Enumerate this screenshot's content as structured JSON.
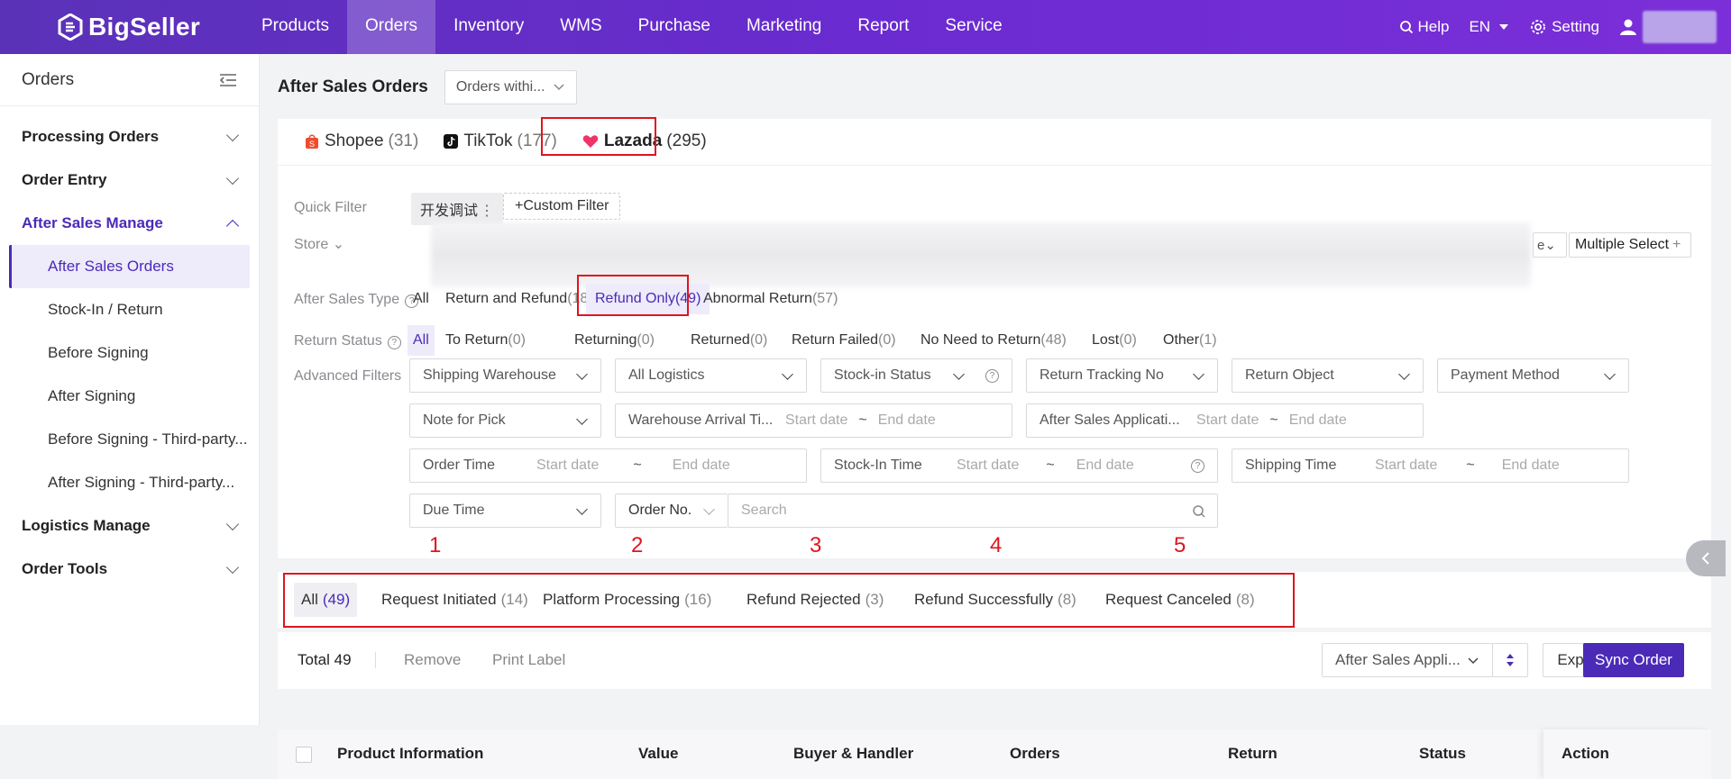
{
  "brand": {
    "name": "BigSeller"
  },
  "nav": {
    "items": [
      "Products",
      "Orders",
      "Inventory",
      "WMS",
      "Purchase",
      "Marketing",
      "Report",
      "Service"
    ],
    "active": "Orders"
  },
  "topright": {
    "help": "Help",
    "lang": "EN",
    "setting": "Setting"
  },
  "sidebar": {
    "title": "Orders",
    "groups": [
      {
        "label": "Processing Orders"
      },
      {
        "label": "Order Entry"
      },
      {
        "label": "After Sales Manage"
      },
      {
        "label": "Logistics Manage"
      },
      {
        "label": "Order Tools"
      }
    ],
    "items": [
      "After Sales Orders",
      "Stock-In / Return",
      "Before Signing",
      "After Signing",
      "Before Signing - Third-party...",
      "After Signing - Third-party..."
    ]
  },
  "page": {
    "title": "After Sales Orders",
    "filter_dropdown": "Orders withi..."
  },
  "platform_tabs": [
    {
      "label": "Shopee",
      "count": "(31)"
    },
    {
      "label": "TikTok",
      "count": "(177)"
    },
    {
      "label": "Lazada",
      "count": "(295)"
    }
  ],
  "filters": {
    "quick_label": "Quick Filter",
    "quick_tag": "开发调试",
    "custom": "Custom Filter",
    "store_label": "Store",
    "multi_select": "Multiple Select",
    "type_label": "After Sales Type",
    "type_options": [
      {
        "label": "All",
        "n": ""
      },
      {
        "label": "Return and Refund",
        "n": "(189)"
      },
      {
        "label": "Refund Only",
        "n": "(49)"
      },
      {
        "label": "Abnormal Return",
        "n": "(57)"
      }
    ],
    "status_label": "Return Status",
    "status_options": [
      {
        "label": "All",
        "n": ""
      },
      {
        "label": "To Return",
        "n": "(0)"
      },
      {
        "label": "Returning",
        "n": "(0)"
      },
      {
        "label": "Returned",
        "n": "(0)"
      },
      {
        "label": "Return Failed",
        "n": "(0)"
      },
      {
        "label": "No Need to Return",
        "n": "(48)"
      },
      {
        "label": "Lost",
        "n": "(0)"
      },
      {
        "label": "Other",
        "n": "(1)"
      }
    ],
    "advanced_label": "Advanced Filters",
    "adv": {
      "shipping_warehouse": "Shipping Warehouse",
      "all_logistics": "All Logistics",
      "stockin_status": "Stock-in Status",
      "return_tracking": "Return Tracking No",
      "return_object": "Return Object",
      "payment_method": "Payment Method",
      "note_pick": "Note for Pick",
      "warehouse_arrival": "Warehouse Arrival Ti...",
      "after_sales_app": "After Sales Applicati...",
      "order_time": "Order Time",
      "stockin_time": "Stock-In Time",
      "shipping_time": "Shipping Time",
      "due_time": "Due Time",
      "order_no": "Order No.",
      "search_ph": "Search",
      "start": "Start date",
      "end": "End date",
      "tilde": "~"
    }
  },
  "annotations": [
    "1",
    "2",
    "3",
    "4",
    "5"
  ],
  "status_tabs": [
    {
      "label": "All",
      "n": "(49)"
    },
    {
      "label": "Request Initiated",
      "n": "(14)"
    },
    {
      "label": "Platform Processing",
      "n": "(16)"
    },
    {
      "label": "Refund Rejected",
      "n": "(3)"
    },
    {
      "label": "Refund Successfully",
      "n": "(8)"
    },
    {
      "label": "Request Canceled",
      "n": "(8)"
    }
  ],
  "toolbar": {
    "total": "Total 49",
    "remove": "Remove",
    "print": "Print Label",
    "sort": "After Sales Appli...",
    "export": "Export",
    "sync": "Sync Order"
  },
  "table_headers": [
    "Product Information",
    "Value",
    "Buyer & Handler",
    "Orders",
    "Return",
    "Status",
    "Action"
  ],
  "colors": {
    "brand": "#5a32b8",
    "primary": "#4b2ab8",
    "highlight_box": "#e0141e"
  }
}
